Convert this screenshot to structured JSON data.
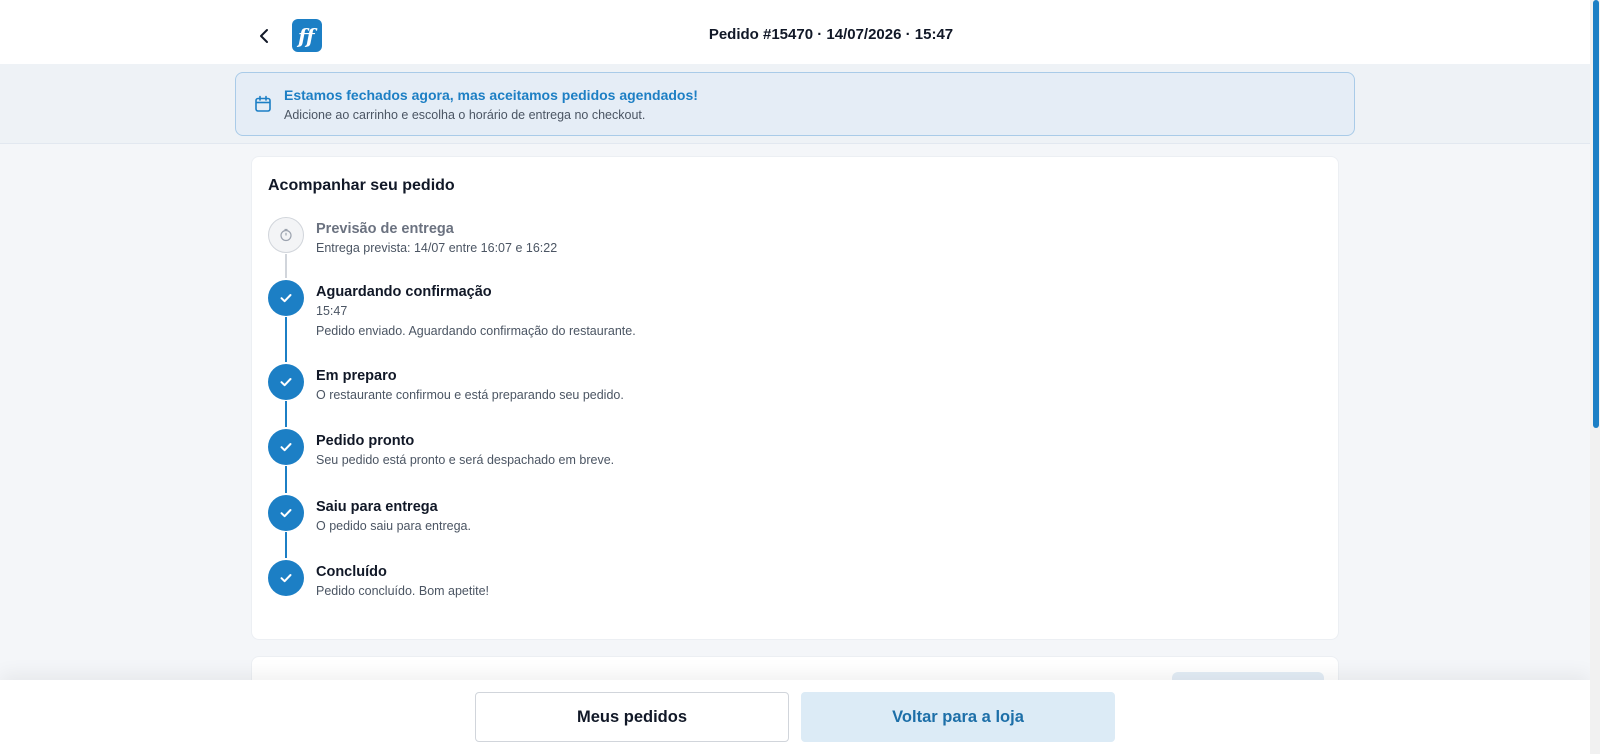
{
  "header": {
    "title": "Pedido #15470 · 14/07/2026 · 15:47",
    "back_icon": "chevron-left-icon",
    "logo_letters": "ff"
  },
  "banner": {
    "icon": "calendar-icon",
    "title": "Estamos fechados agora, mas aceitamos pedidos agendados!",
    "subtitle": "Adicione ao carrinho e escolha o horário de entrega no checkout."
  },
  "tracking": {
    "title": "Acompanhar seu pedido",
    "steps": [
      {
        "title": "Previsão de entrega",
        "lines": [
          "Entrega prevista: 14/07 entre 16:07 e 16:22"
        ],
        "status": "pending",
        "icon": "clock-icon"
      },
      {
        "title": "Aguardando confirmação",
        "lines": [
          "15:47",
          "Pedido enviado. Aguardando confirmação do restaurante."
        ],
        "status": "done",
        "icon": "check-icon"
      },
      {
        "title": "Em preparo",
        "lines": [
          "O restaurante confirmou e está preparando seu pedido."
        ],
        "status": "done",
        "icon": "check-icon"
      },
      {
        "title": "Pedido pronto",
        "lines": [
          "Seu pedido está pronto e será despachado em breve."
        ],
        "status": "done",
        "icon": "check-icon"
      },
      {
        "title": "Saiu para entrega",
        "lines": [
          "O pedido saiu para entrega."
        ],
        "status": "done",
        "icon": "check-icon"
      },
      {
        "title": "Concluído",
        "lines": [
          "Pedido concluído. Bom apetite!"
        ],
        "status": "done",
        "icon": "check-icon"
      }
    ]
  },
  "footer": {
    "my_orders_label": "Meus pedidos",
    "back_to_store_label": "Voltar para a loja"
  },
  "colors": {
    "accent": "#1c7fc5",
    "banner_bg": "#e5edf6",
    "banner_border": "#a9cbe8",
    "primary_button_bg": "#dcebf6"
  }
}
